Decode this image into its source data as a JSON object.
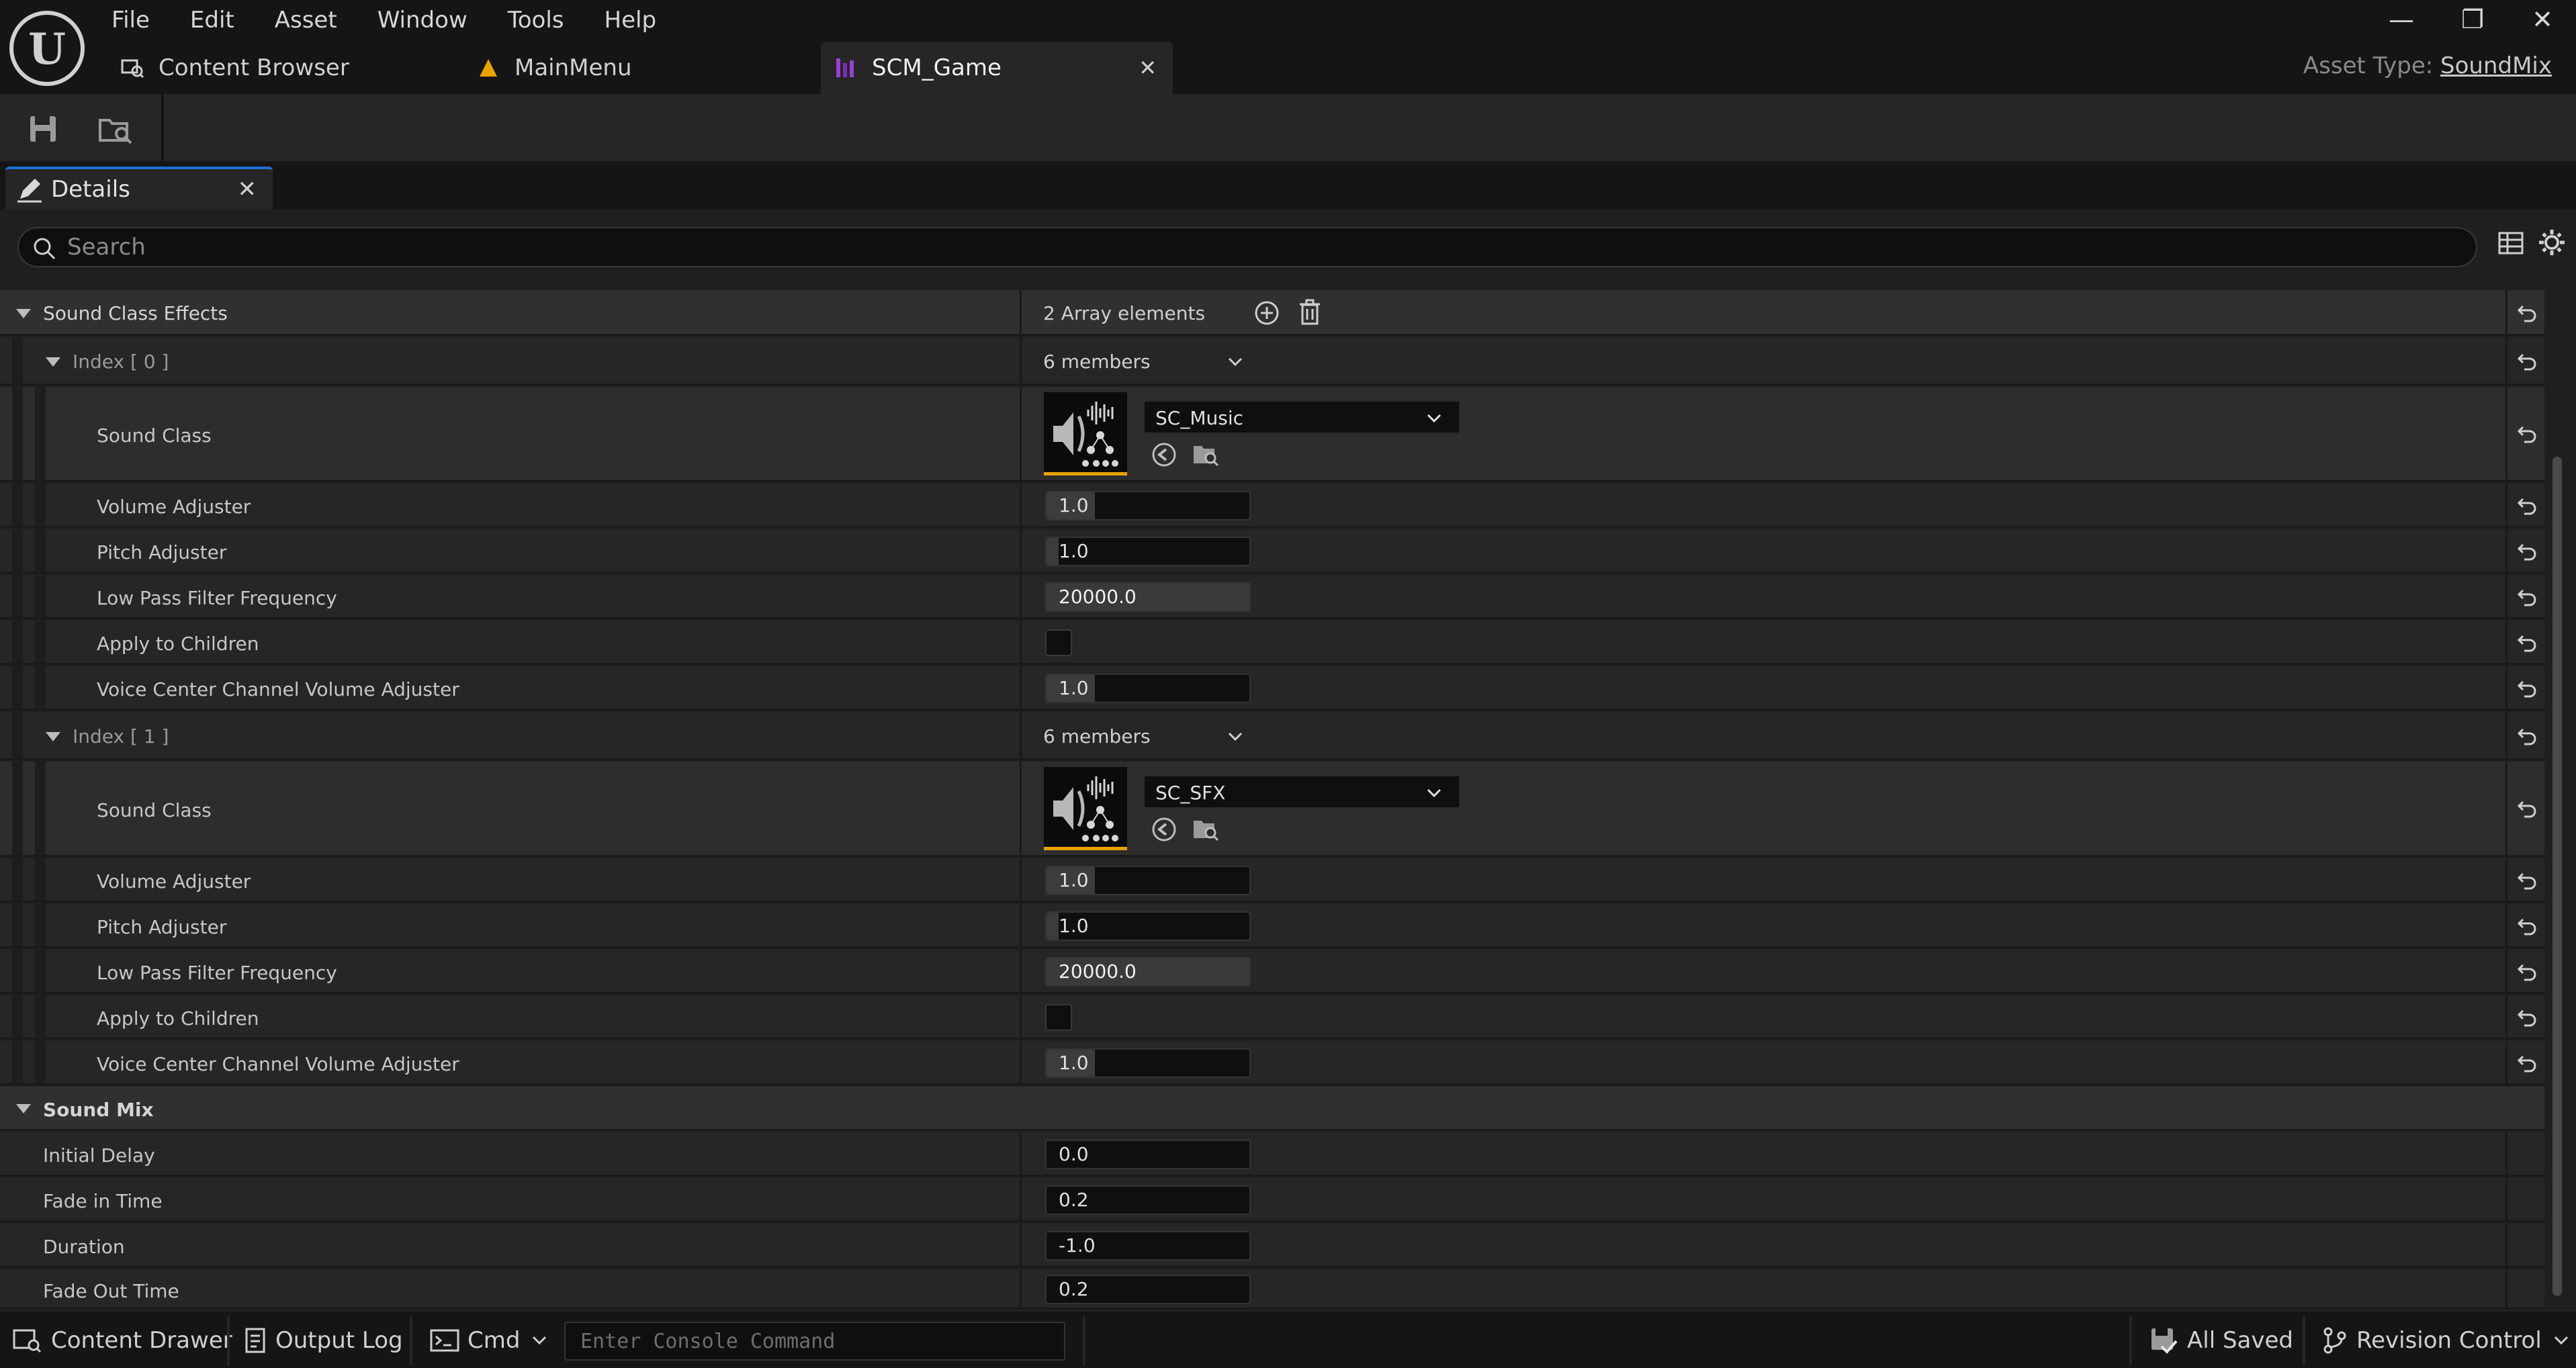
{
  "menu": [
    "File",
    "Edit",
    "Asset",
    "Window",
    "Tools",
    "Help"
  ],
  "tabs": [
    {
      "label": "Content Browser",
      "icon": "content-browser-icon"
    },
    {
      "label": "MainMenu",
      "icon": "level-icon"
    },
    {
      "label": "SCM_Game",
      "icon": "sound-mix-icon",
      "active": true
    }
  ],
  "asset_type": {
    "label": "Asset Type:",
    "value": "SoundMix"
  },
  "details": {
    "tab_label": "Details",
    "search_placeholder": "Search",
    "sound_class_effects": {
      "label": "Sound Class Effects",
      "value": "2 Array elements",
      "indices": [
        {
          "label": "Index [ 0 ]",
          "members": "6 members",
          "sound_class_label": "Sound Class",
          "sound_class_value": "SC_Music",
          "volume_label": "Volume Adjuster",
          "volume": "1.0",
          "pitch_label": "Pitch Adjuster",
          "pitch": "1.0",
          "lpf_label": "Low Pass Filter Frequency",
          "lpf": "20000.0",
          "apply_label": "Apply to Children",
          "voice_label": "Voice Center Channel Volume Adjuster",
          "voice": "1.0"
        },
        {
          "label": "Index [ 1 ]",
          "members": "6 members",
          "sound_class_label": "Sound Class",
          "sound_class_value": "SC_SFX",
          "volume_label": "Volume Adjuster",
          "volume": "1.0",
          "pitch_label": "Pitch Adjuster",
          "pitch": "1.0",
          "lpf_label": "Low Pass Filter Frequency",
          "lpf": "20000.0",
          "apply_label": "Apply to Children",
          "voice_label": "Voice Center Channel Volume Adjuster",
          "voice": "1.0"
        }
      ]
    },
    "sound_mix": {
      "label": "Sound Mix",
      "initial_delay_label": "Initial Delay",
      "initial_delay": "0.0",
      "fade_in_label": "Fade in Time",
      "fade_in": "0.2",
      "duration_label": "Duration",
      "duration": "-1.0",
      "fade_out_label": "Fade Out Time",
      "fade_out": "0.2"
    }
  },
  "statusbar": {
    "content_drawer": "Content Drawer",
    "output_log": "Output Log",
    "cmd": "Cmd",
    "console_placeholder": "Enter Console Command",
    "all_saved": "All Saved",
    "revision_control": "Revision Control"
  },
  "colors": {
    "accent": "#1f6fd6",
    "thumbnail_underline": "#e8a200",
    "sound_mix_icon": "#9b3fd1"
  }
}
